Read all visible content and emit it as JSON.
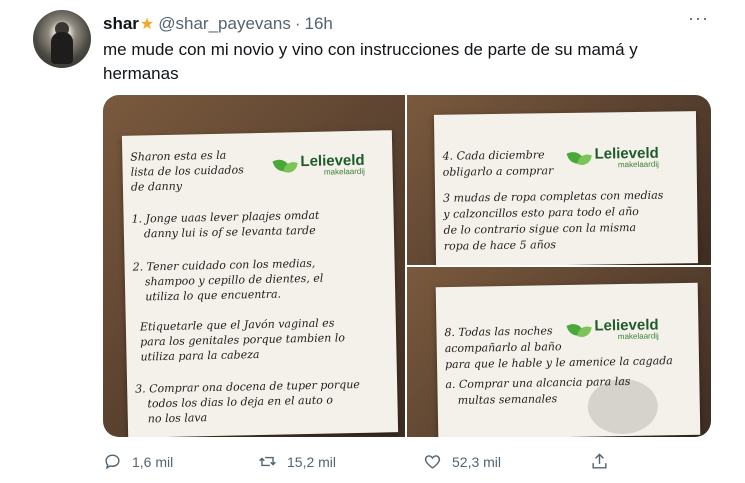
{
  "tweet": {
    "name": "shar",
    "badge_icon": "star-icon",
    "handle": "@shar_payevans",
    "separator": "·",
    "time": "16h",
    "more_label": "···",
    "text": "me mude con mi novio y vino con instrucciones de parte de su mamá y hermanas"
  },
  "photos": [
    {
      "logo_name": "Lelieveld",
      "logo_sub": "makelaardij",
      "lines": [
        "Sharon esta es la",
        "lista de los cuidados",
        "de danny",
        "1. Jonge uaas lever plaajes omdat",
        "danny lui is of se levanta tarde",
        "2. Tener cuidado con los medias,",
        "shampoo y cepillo de dientes, el",
        "utiliza lo que encuentra.",
        "Etiquetarle que el Javón vaginal es",
        "para los genitales porque tambien lo",
        "utiliza para la cabeza",
        "3. Comprar ona docena de tuper porque",
        "todos los dias lo deja en el auto o",
        "no los lava"
      ]
    },
    {
      "logo_name": "Lelieveld",
      "logo_sub": "makelaardij",
      "lines": [
        "4. Cada diciembre",
        "obligarlo a comprar",
        "3 mudas de ropa completas con medias",
        "y calzoncillos esto para todo el año",
        "de lo contrario sigue con la misma",
        "ropa de hace 5 años"
      ]
    },
    {
      "logo_name": "Lelieveld",
      "logo_sub": "makelaardij",
      "lines": [
        "8. Todas las noches",
        "acompañarlo al baño",
        "para que le hable y le amenice la cagada",
        "a. Comprar una alcancia para las",
        "multas semanales"
      ]
    }
  ],
  "actions": {
    "replies": "1,6 mil",
    "retweets": "15,2 mil",
    "likes": "52,3 mil"
  },
  "colors": {
    "text_primary": "#0f1419",
    "text_secondary": "#536471",
    "badge": "#f4a62a",
    "logo_green": "#1f5b2a"
  }
}
